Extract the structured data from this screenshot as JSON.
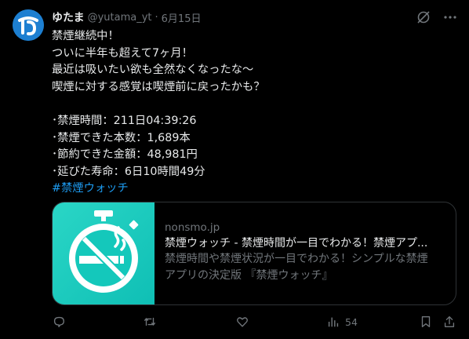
{
  "user": {
    "name": "ゆたま",
    "handle": "@yutama_yt",
    "separator": "·",
    "date": "6月15日"
  },
  "tweet": {
    "lines": [
      "禁煙継続中！",
      "ついに半年も超えて7ヶ月！",
      "最近は吸いたい欲も全然なくなったな〜",
      "喫煙に対する感覚は喫煙前に戻ったかも？",
      "",
      "･禁煙時間：211日04:39:26",
      "･禁煙できた本数：1,689本",
      "･節約できた金額：48,981円",
      "･延びた寿命：6日10時間49分"
    ],
    "hashtag": "#禁煙ウォッチ"
  },
  "card": {
    "domain": "nonsmo.jp",
    "title": "禁煙ウォッチ - 禁煙時間が一目でわかる！禁煙アプ...",
    "description_lines": [
      "禁煙時間や禁煙状況が一目でわかる！シンプルな禁煙",
      "アプリの決定版 『禁煙ウォッチ』"
    ]
  },
  "actions": {
    "views_count": "54"
  },
  "colors": {
    "background": "#000000",
    "text": "#e7e9ea",
    "muted": "#71767b",
    "link": "#1d9bf0",
    "card_thumb": "#14c8bb",
    "avatar": "#1d7fd1"
  }
}
